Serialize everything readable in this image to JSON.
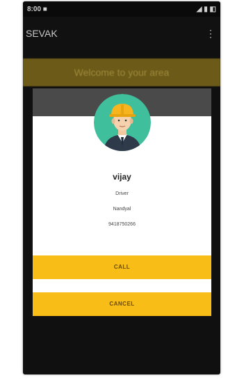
{
  "status_bar": {
    "left": "8:00 ■",
    "right": "◢ ▮ ◧"
  },
  "app_bar": {
    "title": "SEVAK",
    "menu_icon": "overflow-menu-icon"
  },
  "banner": {
    "text": "Welcome to your area"
  },
  "dialog": {
    "avatar_icon": "worker-avatar-icon",
    "name": "vijay",
    "role": "Driver",
    "location": "Nandyal",
    "phone": "9418750266",
    "call_label": "CALL",
    "cancel_label": "CANCEL"
  },
  "colors": {
    "button": "#f9bd18",
    "banner": "#6b5a18",
    "dialog_header": "#4a4a4a",
    "avatar_bg": "#3fbf9c",
    "helmet": "#f6b51e"
  }
}
